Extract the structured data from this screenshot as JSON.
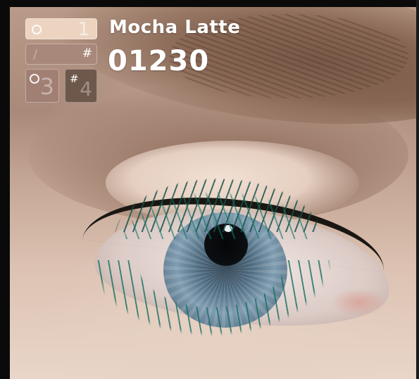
{
  "product": {
    "name": "Mocha Latte",
    "code": "01230"
  },
  "palette": {
    "swatches": [
      {
        "id": 1,
        "marker": "1",
        "color": "#ecd4c1"
      },
      {
        "id": 2,
        "marker": "#",
        "color": "#a8887a"
      },
      {
        "id": 3,
        "marker": "3",
        "color": "#a17f73"
      },
      {
        "id": 4,
        "marker": "4",
        "color": "#6e574b"
      }
    ]
  },
  "colors": {
    "mascara": "#1e8a78",
    "iris": "#6f8ea5",
    "skin": "#d9bfae"
  }
}
